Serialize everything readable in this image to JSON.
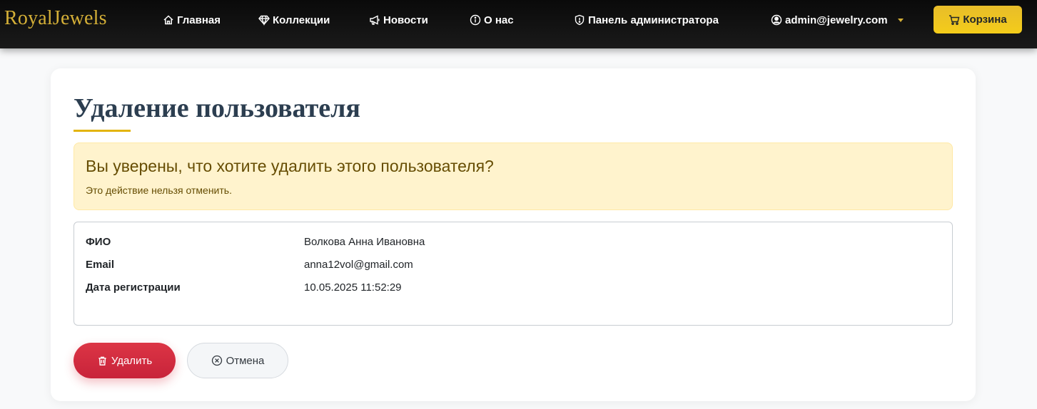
{
  "navbar": {
    "brand": "RoyalJewels",
    "items": [
      {
        "label": "Главная",
        "icon": "home-icon"
      },
      {
        "label": "Коллекции",
        "icon": "gem-icon"
      },
      {
        "label": "Новости",
        "icon": "megaphone-icon"
      },
      {
        "label": "О нас",
        "icon": "info-icon"
      },
      {
        "label": "Панель администратора",
        "icon": "shield-icon"
      },
      {
        "label": "admin@jewelry.com",
        "icon": "user-circle-icon"
      }
    ],
    "cart_label": "Корзина",
    "cart_icon": "cart-icon"
  },
  "page": {
    "title": "Удаление пользователя"
  },
  "alert": {
    "heading": "Вы уверены, что хотите удалить этого пользователя?",
    "text": "Это действие нельзя отменить."
  },
  "user": {
    "fields": [
      {
        "label": "ФИО",
        "value": "Волкова Анна Ивановна"
      },
      {
        "label": "Email",
        "value": "anna12vol@gmail.com"
      },
      {
        "label": "Дата регистрации",
        "value": "10.05.2025 11:52:29"
      }
    ]
  },
  "actions": {
    "delete_label": "Удалить",
    "delete_icon": "trash-icon",
    "cancel_label": "Отмена",
    "cancel_icon": "x-circle-icon"
  },
  "colors": {
    "brand_gold": "#d4af37",
    "accent_yellow": "#f4cc1a",
    "danger": "#dc3545",
    "warning_bg": "#fff3cd",
    "warning_text": "#664d03",
    "heading": "#2c3e50"
  }
}
